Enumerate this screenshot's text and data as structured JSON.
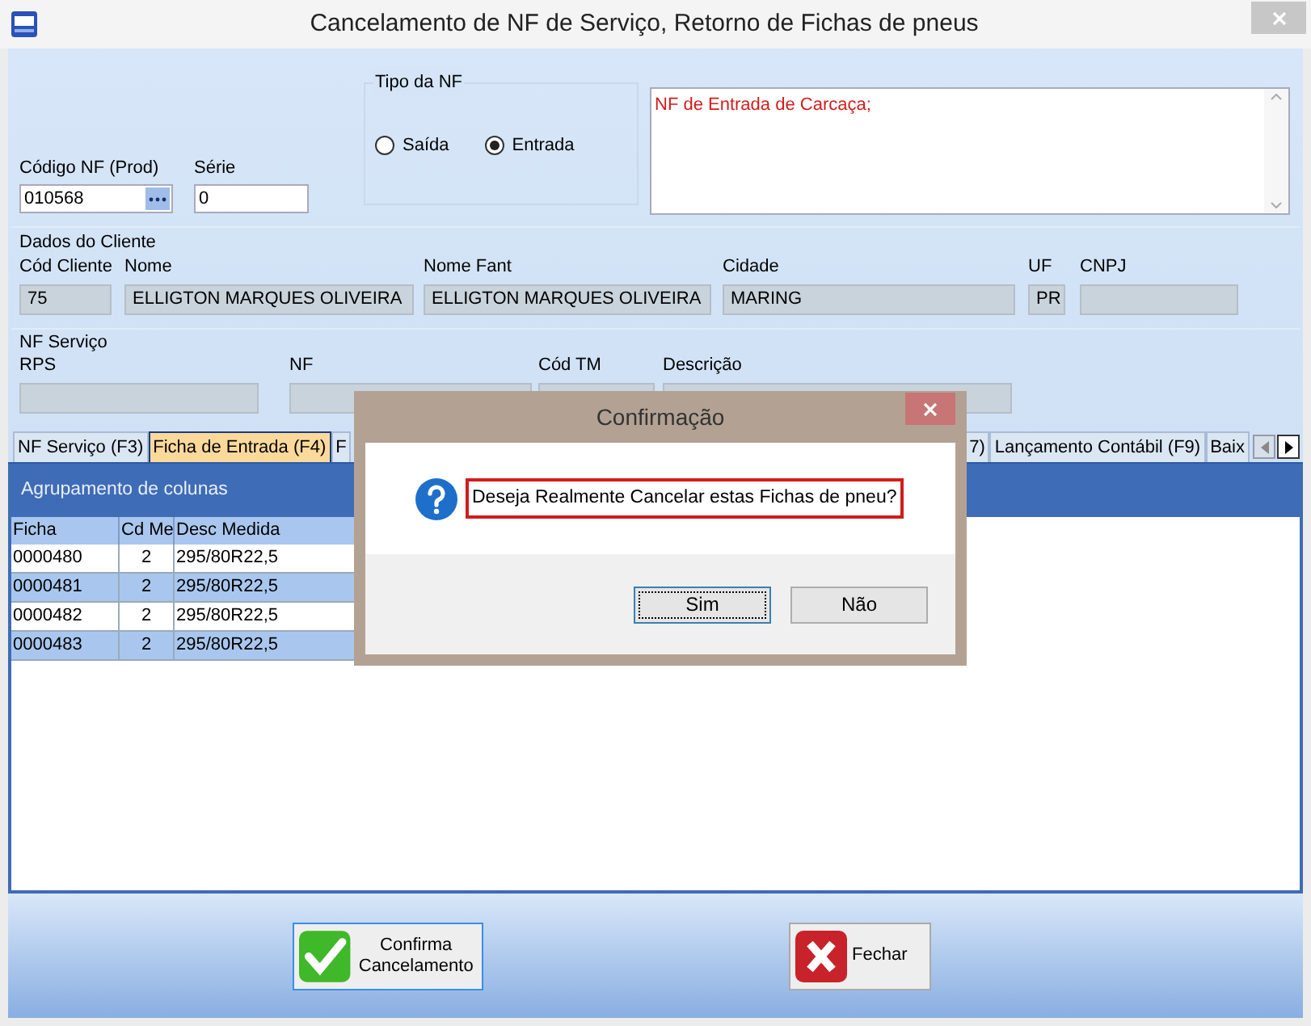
{
  "window": {
    "title": "Cancelamento de NF de Serviço, Retorno de Fichas de pneus"
  },
  "nf": {
    "codigo_label": "Código NF (Prod)",
    "codigo_value": "010568",
    "serie_label": "Série",
    "serie_value": "0"
  },
  "tipo_nf": {
    "legend": "Tipo da NF",
    "options": [
      {
        "label": "Saída",
        "selected": false
      },
      {
        "label": "Entrada",
        "selected": true
      }
    ]
  },
  "notes": {
    "value": "NF de Entrada de Carcaça;"
  },
  "cliente": {
    "title": "Dados do Cliente",
    "fields": [
      {
        "label": "Cód Cliente",
        "value": "75"
      },
      {
        "label": "Nome",
        "value": "ELLIGTON MARQUES OLIVEIRA"
      },
      {
        "label": "Nome Fant",
        "value": "ELLIGTON MARQUES OLIVEIRA"
      },
      {
        "label": "Cidade",
        "value": "MARING"
      },
      {
        "label": "UF",
        "value": "PR"
      },
      {
        "label": "CNPJ"
      }
    ]
  },
  "nf_servico": {
    "title": "NF Serviço",
    "fields": [
      {
        "label": "RPS"
      },
      {
        "label": "NF"
      },
      {
        "label": "Cód TM"
      },
      {
        "label": "Descrição"
      }
    ]
  },
  "tabs": [
    {
      "label": "NF Serviço (F3)",
      "selected": false
    },
    {
      "label": "Ficha de Entrada (F4)",
      "selected": true
    },
    {
      "label": "F",
      "selected": false
    },
    {
      "label": "7)",
      "selected": false
    },
    {
      "label": "Lançamento Contábil (F9)",
      "selected": false
    },
    {
      "label": "Baix",
      "selected": false
    }
  ],
  "grid": {
    "group_header": "Agrupamento de colunas",
    "columns": [
      "Ficha",
      "Cd Me",
      "Desc Medida"
    ],
    "rows": [
      {
        "cells": [
          "0000480",
          "2",
          "295/80R22,5"
        ],
        "selected": false
      },
      {
        "cells": [
          "0000481",
          "2",
          "295/80R22,5"
        ],
        "selected": true
      },
      {
        "cells": [
          "0000482",
          "2",
          "295/80R22,5"
        ],
        "selected": false
      },
      {
        "cells": [
          "0000483",
          "2",
          "295/80R22,5"
        ],
        "selected": true
      }
    ]
  },
  "dialog": {
    "title": "Confirmação",
    "message": "Deseja Realmente Cancelar estas Fichas de pneu?",
    "buttons": [
      {
        "label": "Sim",
        "default": true
      },
      {
        "label": "Não",
        "default": false
      }
    ]
  },
  "buttons": [
    {
      "label": "Confirma Cancelamento",
      "kind": "confirm"
    },
    {
      "label": "Fechar",
      "kind": "close"
    }
  ]
}
